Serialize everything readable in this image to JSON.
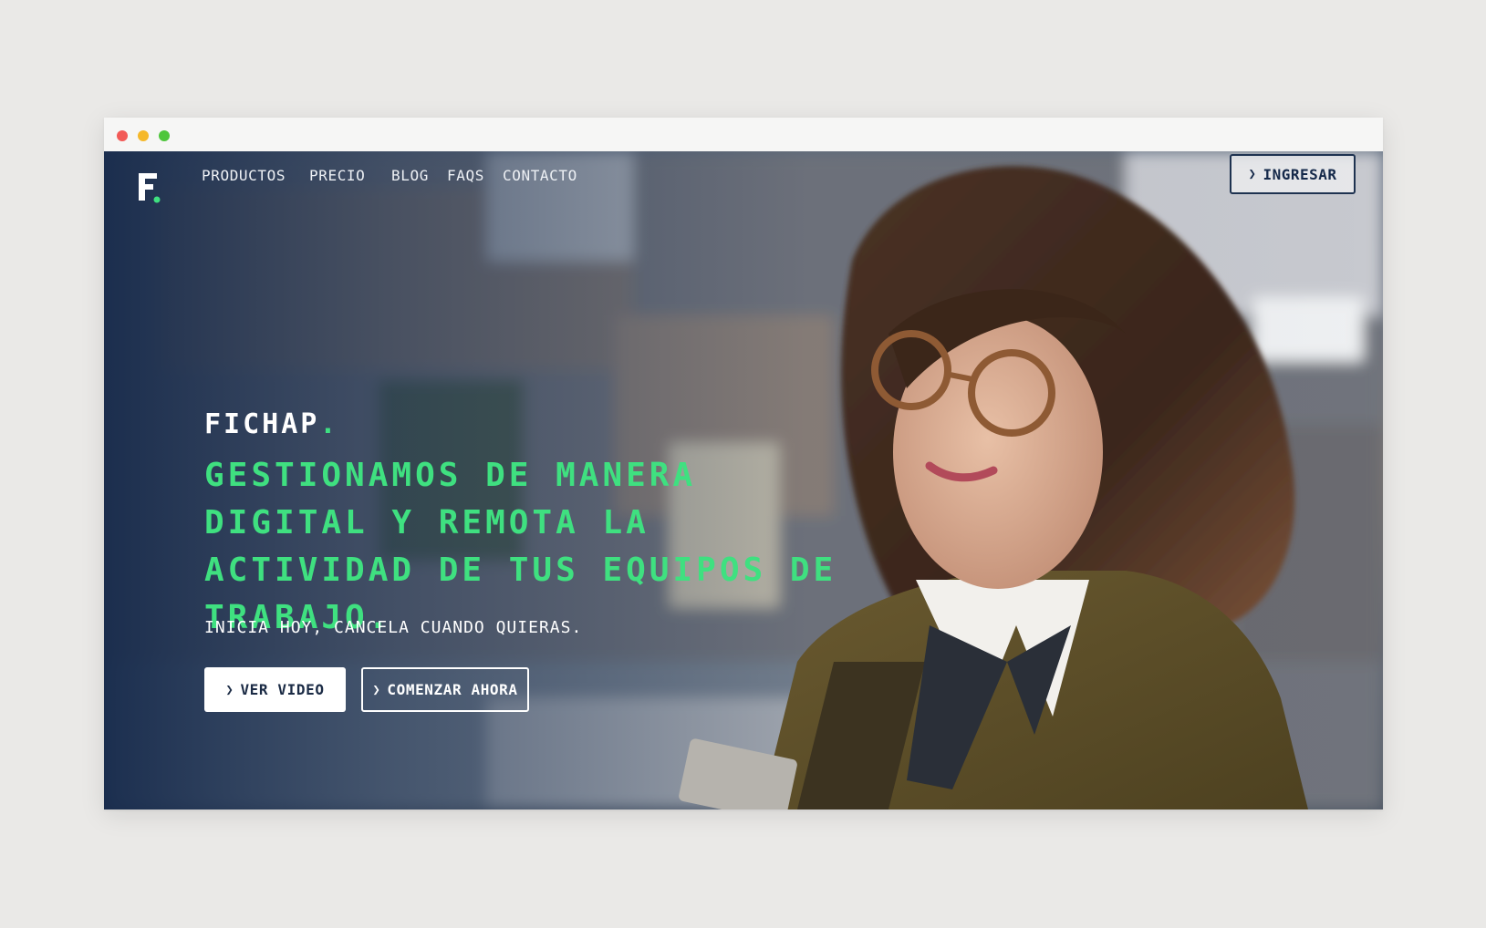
{
  "window": {
    "controls": [
      "close",
      "minimize",
      "maximize"
    ]
  },
  "nav": {
    "links": [
      {
        "label": "PRODUCTOS"
      },
      {
        "label": "PRECIO"
      },
      {
        "label": "BLOG"
      },
      {
        "label": "FAQS"
      },
      {
        "label": "CONTACTO"
      }
    ],
    "login_label": "INGRESAR",
    "login_icon": "chevron-right-icon"
  },
  "hero": {
    "brand": "FICHAP",
    "brand_dot": ".",
    "headline": "GESTIONAMOS DE MANERA DIGITAL Y REMOTA LA ACTIVIDAD DE TUS EQUIPOS DE TRABAJO.",
    "tagline": "INICIA HOY, CANCELA CUANDO QUIERAS.",
    "primary_button": "VER VIDEO",
    "secondary_button": "COMENZAR AHORA",
    "button_icon": "chevron-right-icon"
  },
  "colors": {
    "accent_green": "#3fe080",
    "navy": "#1b2b45",
    "white": "#ffffff",
    "page_bg": "#eae9e7"
  }
}
